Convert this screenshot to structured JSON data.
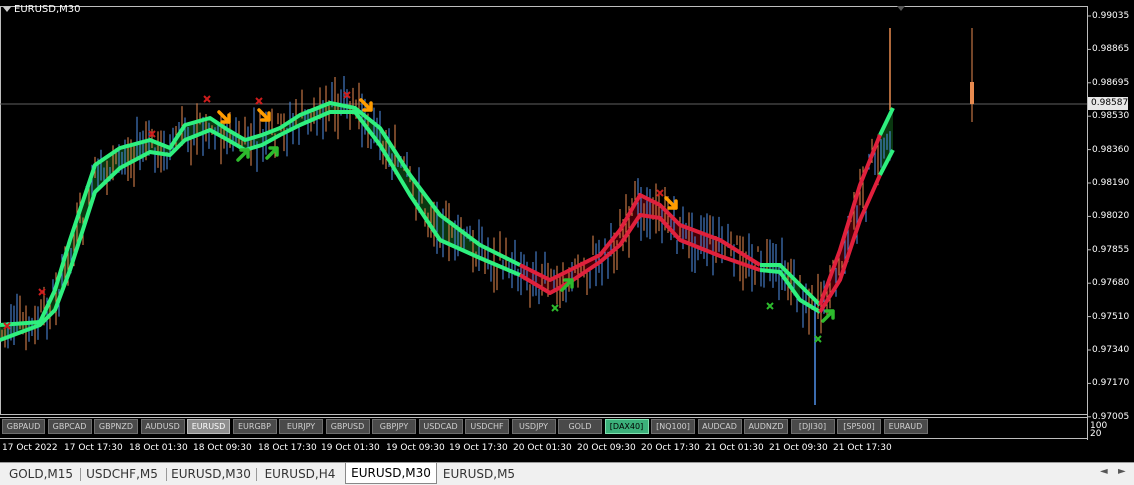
{
  "chart": {
    "title": "EURUSD,M30",
    "current_price": "0.98587",
    "price_labels": [
      "0.99035",
      "0.98865",
      "0.98695",
      "0.98530",
      "0.98360",
      "0.98190",
      "0.98020",
      "0.97855",
      "0.97680",
      "0.97510",
      "0.97340",
      "0.97170",
      "0.97005"
    ],
    "time_labels": [
      "17 Oct 2022",
      "17 Oct 17:30",
      "18 Oct 01:30",
      "18 Oct 09:30",
      "18 Oct 17:30",
      "19 Oct 01:30",
      "19 Oct 09:30",
      "19 Oct 17:30",
      "20 Oct 01:30",
      "20 Oct 09:30",
      "20 Oct 17:30",
      "21 Oct 01:30",
      "21 Oct 09:30",
      "21 Oct 17:30"
    ],
    "subwindow_labels": [
      "100",
      "20"
    ]
  },
  "colors": {
    "bull": "#4f8fe8",
    "bear": "#e88a4f",
    "ma_up": "#2ef07e",
    "ma_down": "#e0203c",
    "fill_up": "#0b3d12",
    "fill_down": "#4a0008",
    "signal_buy": "#2dbb2d",
    "signal_sell": "#ff9c00",
    "cross_red": "#cc1c1c"
  },
  "symbols": [
    {
      "label": "GBPAUD"
    },
    {
      "label": "GBPCAD"
    },
    {
      "label": "GBPNZD"
    },
    {
      "label": "AUDUSD"
    },
    {
      "label": "EURUSD",
      "active": true
    },
    {
      "label": "EURGBP"
    },
    {
      "label": "EURJPY"
    },
    {
      "label": "GBPUSD"
    },
    {
      "label": "GBPJPY"
    },
    {
      "label": "USDCAD"
    },
    {
      "label": "USDCHF"
    },
    {
      "label": "USDJPY"
    },
    {
      "label": "GOLD"
    },
    {
      "label": "[DAX40]",
      "green": true
    },
    {
      "label": "[NQ100]"
    },
    {
      "label": "AUDCAD"
    },
    {
      "label": "AUDNZD"
    },
    {
      "label": "[DJI30]"
    },
    {
      "label": "[SP500]"
    },
    {
      "label": "EURAUD"
    }
  ],
  "tabs": [
    {
      "label": "GOLD,M15"
    },
    {
      "label": "USDCHF,M5"
    },
    {
      "label": "EURUSD,M30"
    },
    {
      "label": "EURUSD,H4"
    },
    {
      "label": "EURUSD,M30",
      "active": true
    },
    {
      "label": "EURUSD,M5"
    }
  ],
  "tab_arrows": {
    "left": "◄",
    "right": "►"
  }
}
